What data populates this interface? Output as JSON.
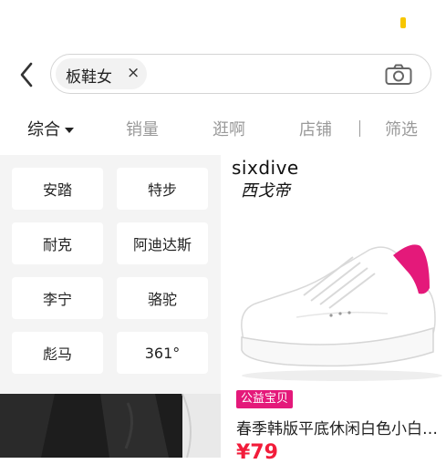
{
  "search": {
    "query_chip": "板鞋女",
    "chip_close": "×"
  },
  "sort_tabs": [
    {
      "label": "综合",
      "active": true
    },
    {
      "label": "销量"
    },
    {
      "label": "逛啊"
    },
    {
      "label": "店铺"
    },
    {
      "label": "筛选"
    }
  ],
  "brands": [
    "安踏",
    "特步",
    "耐克",
    "阿迪达斯",
    "李宁",
    "骆驼",
    "彪马",
    "361°"
  ],
  "product": {
    "brand_logo": "sixdive",
    "brand_sub": "西戈帝",
    "badge": "公益宝贝",
    "title": "春季韩版平底休闲白色小白鞋女",
    "price": "¥79"
  },
  "colors": {
    "accent_pink": "#e4197a",
    "price_red": "#f21c3a",
    "status_yellow": "#f7c600"
  }
}
